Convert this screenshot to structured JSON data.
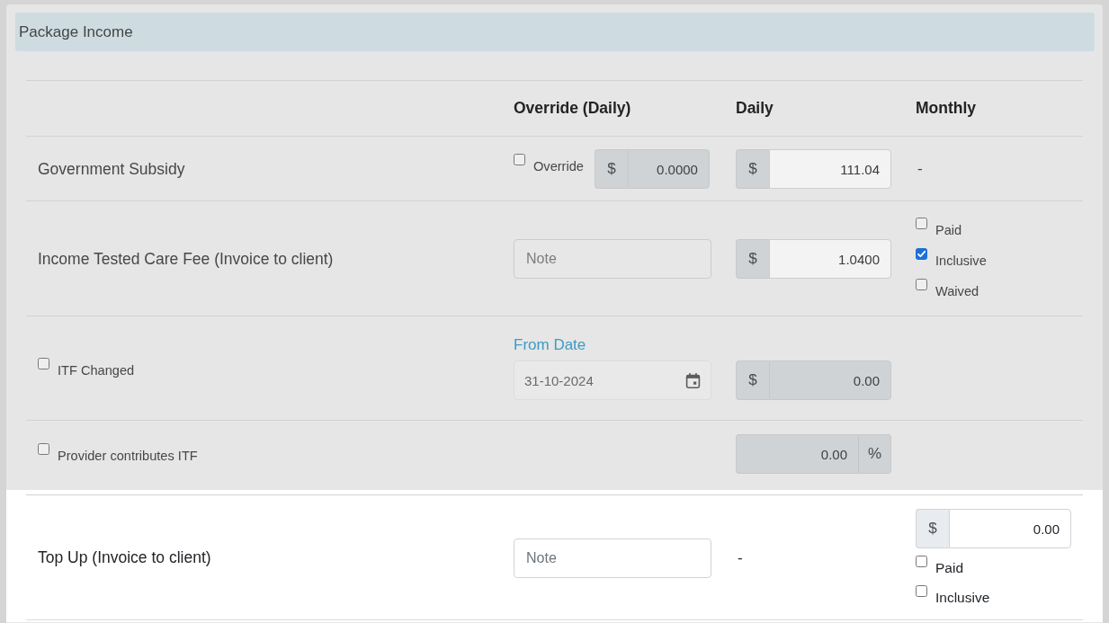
{
  "section": {
    "title": "Package Income"
  },
  "columns": [
    "Override (Daily)",
    "Daily",
    "Monthly"
  ],
  "rows": [
    {
      "label": {
        "kind": "text",
        "text": "Government Subsidy"
      },
      "highlighted": false,
      "override": [
        {
          "kind": "checkbox",
          "label": "Override",
          "checked": false
        },
        {
          "kind": "amount",
          "prefix": "$",
          "value": "0.0000",
          "disabled": true
        }
      ],
      "daily": [
        {
          "kind": "amount",
          "prefix": "$",
          "value": "111.04",
          "disabled": false
        }
      ],
      "monthly": [
        {
          "kind": "text",
          "text": "-"
        }
      ]
    },
    {
      "label": {
        "kind": "text",
        "text": "Income Tested Care Fee (Invoice to client)"
      },
      "highlighted": false,
      "override": [
        {
          "kind": "note",
          "placeholder": "Note"
        }
      ],
      "daily": [
        {
          "kind": "amount",
          "prefix": "$",
          "value": "1.0400",
          "disabled": false
        }
      ],
      "monthly": [
        {
          "kind": "checkbox",
          "label": "Paid",
          "checked": false
        },
        {
          "kind": "checkbox",
          "label": "Inclusive",
          "checked": true
        },
        {
          "kind": "checkbox",
          "label": "Waived",
          "checked": false
        }
      ]
    },
    {
      "label": {
        "kind": "checkbox",
        "label": "ITF Changed",
        "checked": false
      },
      "highlighted": false,
      "override": [
        {
          "kind": "date",
          "caption": "From Date",
          "value": "31-10-2024",
          "disabled": true
        }
      ],
      "daily": [
        {
          "kind": "amount",
          "prefix": "$",
          "value": "0.00",
          "disabled": true
        }
      ]
    },
    {
      "label": {
        "kind": "checkbox",
        "label": "Provider contributes ITF",
        "checked": false
      },
      "highlighted": false,
      "daily": [
        {
          "kind": "amount",
          "suffix": "%",
          "value": "0.00",
          "disabled": true
        }
      ]
    },
    {
      "label": {
        "kind": "text",
        "text": "Top Up (Invoice to client)"
      },
      "highlighted": true,
      "override": [
        {
          "kind": "note",
          "placeholder": "Note"
        }
      ],
      "daily": [
        {
          "kind": "text",
          "text": "-"
        }
      ],
      "monthly": [
        {
          "kind": "amount",
          "prefix": "$",
          "value": "0.00",
          "disabled": false
        },
        {
          "kind": "checkbox",
          "label": "Paid",
          "checked": false
        },
        {
          "kind": "checkbox",
          "label": "Inclusive",
          "checked": false
        }
      ]
    }
  ]
}
